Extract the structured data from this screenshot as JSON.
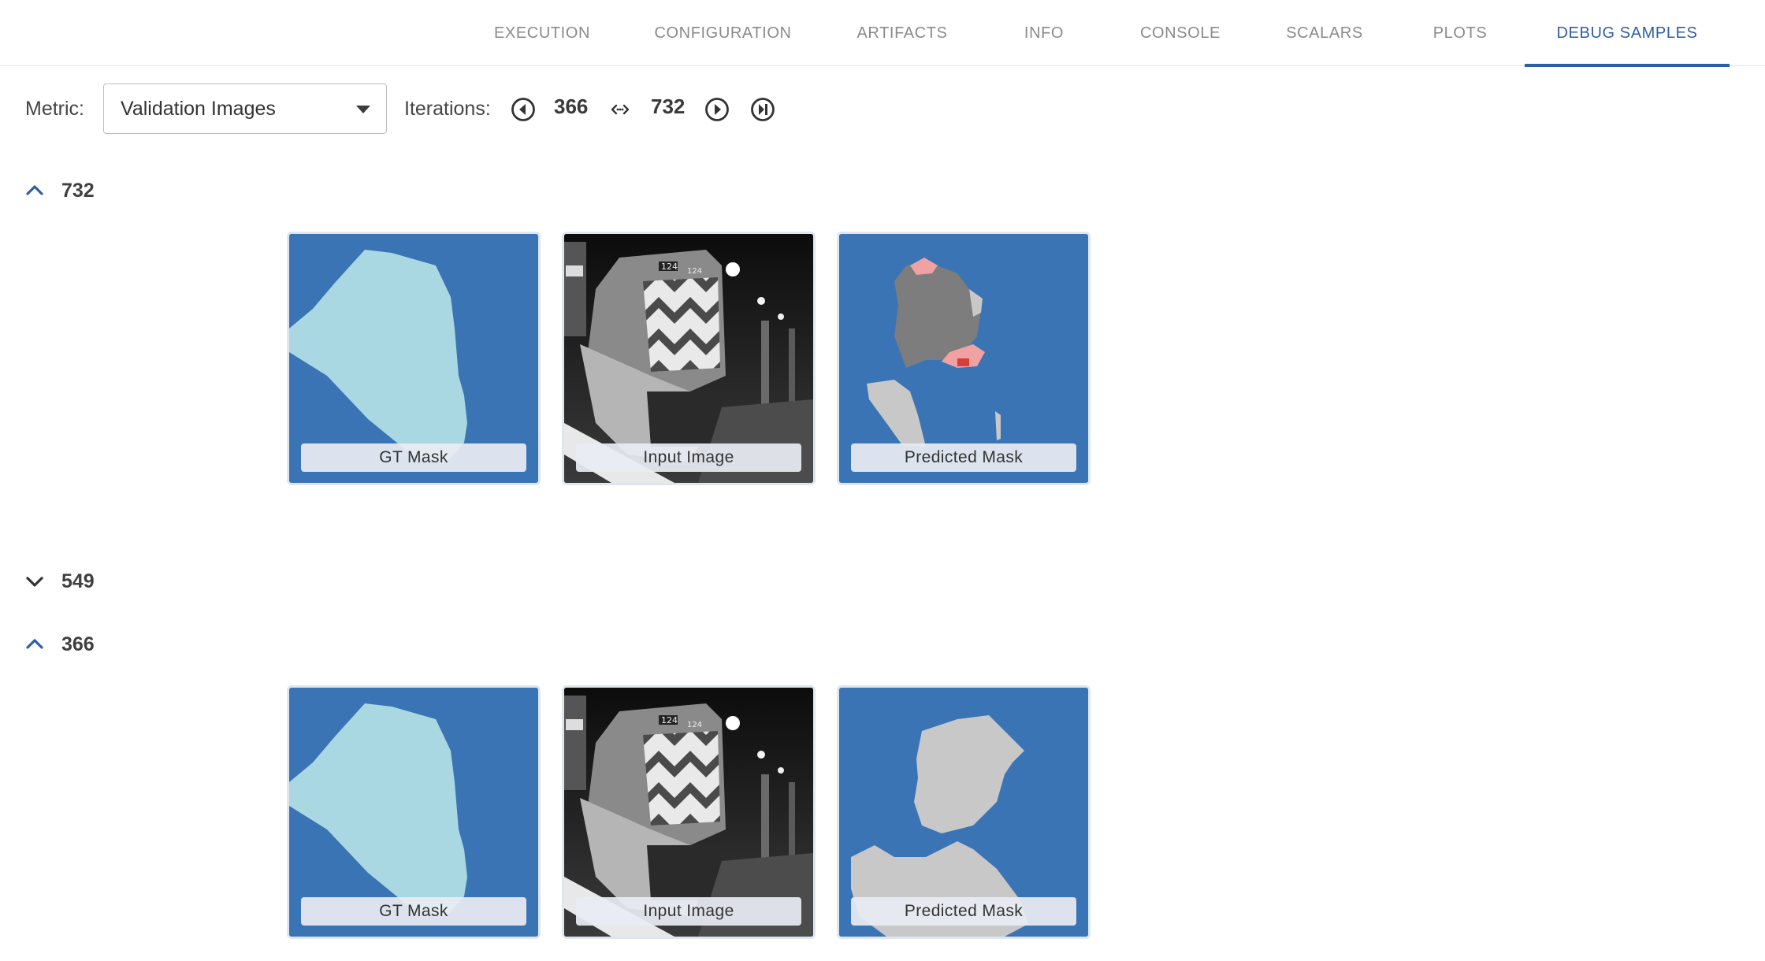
{
  "tabs": [
    {
      "label": "EXECUTION",
      "active": false
    },
    {
      "label": "CONFIGURATION",
      "active": false
    },
    {
      "label": "ARTIFACTS",
      "active": false
    },
    {
      "label": "INFO",
      "active": false
    },
    {
      "label": "CONSOLE",
      "active": false
    },
    {
      "label": "SCALARS",
      "active": false
    },
    {
      "label": "PLOTS",
      "active": false
    },
    {
      "label": "DEBUG SAMPLES",
      "active": true
    }
  ],
  "toolbar": {
    "metric_label": "Metric:",
    "metric_value": "Validation Images",
    "iterations_label": "Iterations:",
    "iter_min": "366",
    "iter_max": "732",
    "range_icon": "range-arrows-icon"
  },
  "sections": [
    {
      "iteration": "732",
      "expanded": true,
      "samples": [
        {
          "caption": "GT Mask",
          "kind": "gt-mask"
        },
        {
          "caption": "Input Image",
          "kind": "input-image"
        },
        {
          "caption": "Predicted Mask",
          "kind": "predicted-mask"
        }
      ]
    },
    {
      "iteration": "549",
      "expanded": false,
      "samples": []
    },
    {
      "iteration": "366",
      "expanded": true,
      "samples": [
        {
          "caption": "GT Mask",
          "kind": "gt-mask"
        },
        {
          "caption": "Input Image",
          "kind": "input-image"
        },
        {
          "caption": "Predicted Mask",
          "kind": "predicted-mask"
        }
      ]
    }
  ],
  "photo_text": {
    "loco_number": "124"
  },
  "colors": {
    "accent": "#2f5fa3",
    "mask_background": "#3b74b4",
    "gt_mask_fill": "#a9d8e3",
    "pred_gray": "#7d7d7d",
    "pred_light": "#c8c8c8",
    "pred_pink": "#f0a2a2",
    "pred_red": "#d6403c"
  }
}
